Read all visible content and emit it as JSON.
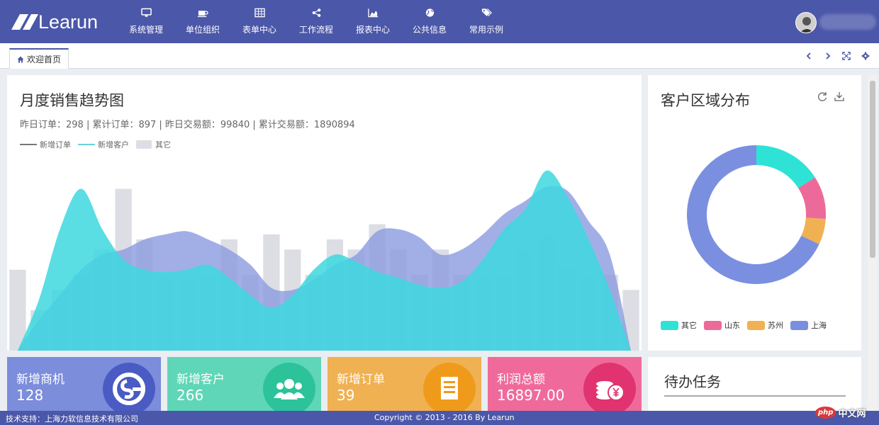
{
  "brand": {
    "name": "Learun"
  },
  "nav": [
    {
      "label": "系统管理",
      "icon": "monitor-icon"
    },
    {
      "label": "单位组织",
      "icon": "coffee-icon"
    },
    {
      "label": "表单中心",
      "icon": "table-icon"
    },
    {
      "label": "工作流程",
      "icon": "share-icon"
    },
    {
      "label": "报表中心",
      "icon": "area-chart-icon"
    },
    {
      "label": "公共信息",
      "icon": "globe-icon"
    },
    {
      "label": "常用示例",
      "icon": "tags-icon"
    }
  ],
  "tabs": [
    {
      "label": "欢迎首页",
      "icon": "home-icon"
    }
  ],
  "tab_controls": [
    "chevron-left-icon",
    "chevron-right-icon",
    "expand-icon",
    "gear-icon"
  ],
  "trend": {
    "title": "月度销售趋势图",
    "summary": "昨日订单：298 | 累计订单：897 | 昨日交易额：99840 | 累计交易额：1890894",
    "legend": [
      "新增订单",
      "新增客户",
      "其它"
    ]
  },
  "region": {
    "title": "客户区域分布",
    "tools": [
      "refresh-icon",
      "download-icon"
    ]
  },
  "stats": [
    {
      "label": "新增商机",
      "value": "128",
      "color": "#7b8ddb",
      "icon_bg": "#4a5bc4",
      "icon": "opportunity-icon"
    },
    {
      "label": "新增客户",
      "value": "266",
      "color": "#5fd6b7",
      "icon_bg": "#2cc29a",
      "icon": "users-icon"
    },
    {
      "label": "新增订单",
      "value": "39",
      "color": "#f0b152",
      "icon_bg": "#ef9a1b",
      "icon": "document-icon"
    },
    {
      "label": "利润总额",
      "value": "16897.00",
      "color": "#ef6a9a",
      "icon_bg": "#e0336f",
      "icon": "coins-icon"
    }
  ],
  "todo": {
    "title": "待办任务"
  },
  "footer": {
    "support": "技术支持：上海力软信息技术有限公司",
    "copyright": "Copyright © 2013 - 2016 By Learun"
  },
  "watermark": {
    "php": "php",
    "text": "中文网"
  },
  "colors": {
    "header": "#4b57a8",
    "series_order": "#8e9de0",
    "series_customer": "#3dd8df",
    "series_other": "#dcdee4"
  },
  "chart_data": {
    "type": "area",
    "title": "月度销售趋势图",
    "series": [
      {
        "name": "新增订单",
        "type": "area",
        "x": [
          1,
          2,
          3,
          4,
          5,
          6,
          7,
          8,
          9,
          10,
          11,
          12,
          13,
          14,
          15,
          16,
          17,
          18,
          19,
          20,
          21,
          22,
          23,
          24,
          25,
          26,
          27,
          28,
          29,
          30
        ],
        "values": [
          0,
          30,
          55,
          80,
          95,
          100,
          110,
          115,
          118,
          110,
          100,
          85,
          62,
          60,
          70,
          85,
          95,
          118,
          120,
          112,
          95,
          100,
          115,
          135,
          148,
          162,
          158,
          128,
          95,
          0
        ]
      },
      {
        "name": "新增客户",
        "type": "area",
        "x": [
          1,
          2,
          3,
          4,
          5,
          6,
          7,
          8,
          9,
          10,
          11,
          12,
          13,
          14,
          15,
          16,
          17,
          18,
          19,
          20,
          21,
          22,
          23,
          24,
          25,
          26,
          27,
          28,
          29,
          30
        ],
        "values": [
          0,
          50,
          120,
          160,
          120,
          90,
          80,
          78,
          80,
          85,
          72,
          55,
          42,
          55,
          80,
          95,
          88,
          78,
          72,
          65,
          62,
          68,
          90,
          120,
          140,
          178,
          152,
          110,
          60,
          0
        ]
      },
      {
        "name": "其它",
        "type": "bar",
        "x": [
          1,
          2,
          3,
          4,
          5,
          6,
          7,
          8,
          9,
          10,
          11,
          12,
          13,
          14,
          15,
          16,
          17,
          18,
          19,
          20,
          21,
          22,
          23,
          24,
          25,
          26,
          27,
          28,
          29,
          30
        ],
        "values": [
          80,
          40,
          60,
          75,
          100,
          160,
          110,
          75,
          70,
          75,
          110,
          75,
          115,
          100,
          75,
          110,
          100,
          125,
          100,
          75,
          100,
          75,
          75,
          75,
          100,
          115,
          80,
          75,
          75,
          60
        ]
      }
    ]
  },
  "pie_data": {
    "type": "pie",
    "slices": [
      {
        "name": "其它",
        "value": 16,
        "color": "#2ee2d6"
      },
      {
        "name": "山东",
        "value": 10,
        "color": "#ec6a9a"
      },
      {
        "name": "苏州",
        "value": 6,
        "color": "#f0b152"
      },
      {
        "name": "上海",
        "value": 68,
        "color": "#7b8fe0"
      }
    ]
  }
}
